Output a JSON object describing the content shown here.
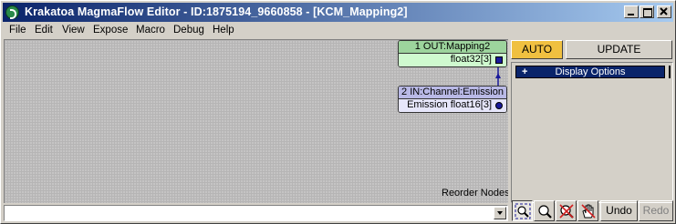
{
  "window": {
    "title": "Krakatoa MagmaFlow Editor - ID:1875194_9660858 - [KCM_Mapping2]"
  },
  "menu": [
    "File",
    "Edit",
    "View",
    "Expose",
    "Macro",
    "Debug",
    "Help"
  ],
  "nodes": {
    "out": {
      "title": "1 OUT:Mapping2",
      "socket": "float32[3]",
      "color": "#9dd49d"
    },
    "in": {
      "title": "2 IN:Channel:Emission",
      "socket": "Emission float16[3]",
      "color": "#b9b9e6"
    }
  },
  "canvas": {
    "reorder_label": "Reorder Nodes"
  },
  "status": {
    "value": ""
  },
  "panel": {
    "auto_label": "AUTO",
    "update_label": "UPDATE",
    "rollout": {
      "expander": "+",
      "label": "Display Options"
    }
  },
  "toolbar": {
    "icons": [
      "zoom-extents-icon",
      "zoom-icon",
      "zoom-reset-icon",
      "pan-hand-icon"
    ],
    "undo_label": "Undo",
    "redo_label": "Redo"
  },
  "colors": {
    "titlebar": "#0a246a",
    "auto_button": "#f0c040",
    "wire": "#1a1a9a"
  }
}
